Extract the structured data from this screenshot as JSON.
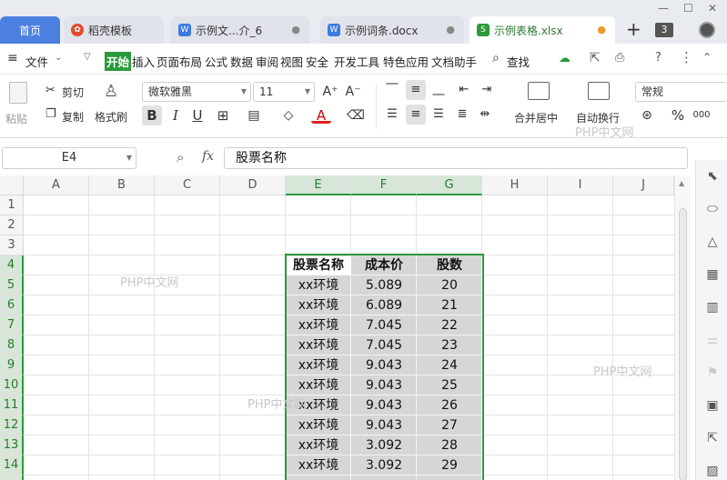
{
  "tabs": {
    "home": "首页",
    "t1": "稻壳模板",
    "t2": "示例文...介_6",
    "t3": "示例词条.docx",
    "t4": "示例表格.xlsx",
    "add": "+",
    "count": "3"
  },
  "menu": {
    "file": "文件",
    "items": [
      "开始",
      "插入",
      "页面布局",
      "公式",
      "数据",
      "审阅",
      "视图",
      "安全",
      "开发工具",
      "特色应用",
      "文档助手"
    ],
    "search": "查找"
  },
  "ribbon": {
    "paste": "粘贴",
    "cut": "剪切",
    "copy": "复制",
    "format_painter": "格式刷",
    "font": "微软雅黑",
    "size": "11",
    "merge": "合并居中",
    "wrap": "自动换行",
    "numfmt": "常规",
    "percent": "%",
    "bold": "B",
    "italic": "I",
    "underline": "U",
    "font_color_a": "A",
    "grow": "A⁺",
    "shrink": "A⁻"
  },
  "formula": {
    "cellref": "E4",
    "fx": "fx",
    "content": "股票名称"
  },
  "columns": [
    "A",
    "B",
    "C",
    "D",
    "E",
    "F",
    "G",
    "H",
    "I",
    "J"
  ],
  "rows": [
    "1",
    "2",
    "3",
    "4",
    "5",
    "6",
    "7",
    "8",
    "9",
    "10",
    "11",
    "12",
    "13",
    "14"
  ],
  "table": {
    "headers": [
      "股票名称",
      "成本价",
      "股数"
    ],
    "rows": [
      [
        "xx环境",
        "5.089",
        "20"
      ],
      [
        "xx环境",
        "6.089",
        "21"
      ],
      [
        "xx环境",
        "7.045",
        "22"
      ],
      [
        "xx环境",
        "7.045",
        "23"
      ],
      [
        "xx环境",
        "9.043",
        "24"
      ],
      [
        "xx环境",
        "9.043",
        "25"
      ],
      [
        "xx环境",
        "9.043",
        "26"
      ],
      [
        "xx环境",
        "9.043",
        "27"
      ],
      [
        "xx环境",
        "3.092",
        "28"
      ],
      [
        "xx环境",
        "3.092",
        "29"
      ]
    ]
  },
  "watermarks": [
    "PHP中文网",
    "PHP中文网",
    "PHP中文网",
    "PHP中文网"
  ],
  "colors": {
    "accent": "#2a9a3a",
    "tab_active_bg": "#ffffff",
    "home_tab": "#4c7fe0",
    "cell_selected": "#d6d6d6"
  }
}
